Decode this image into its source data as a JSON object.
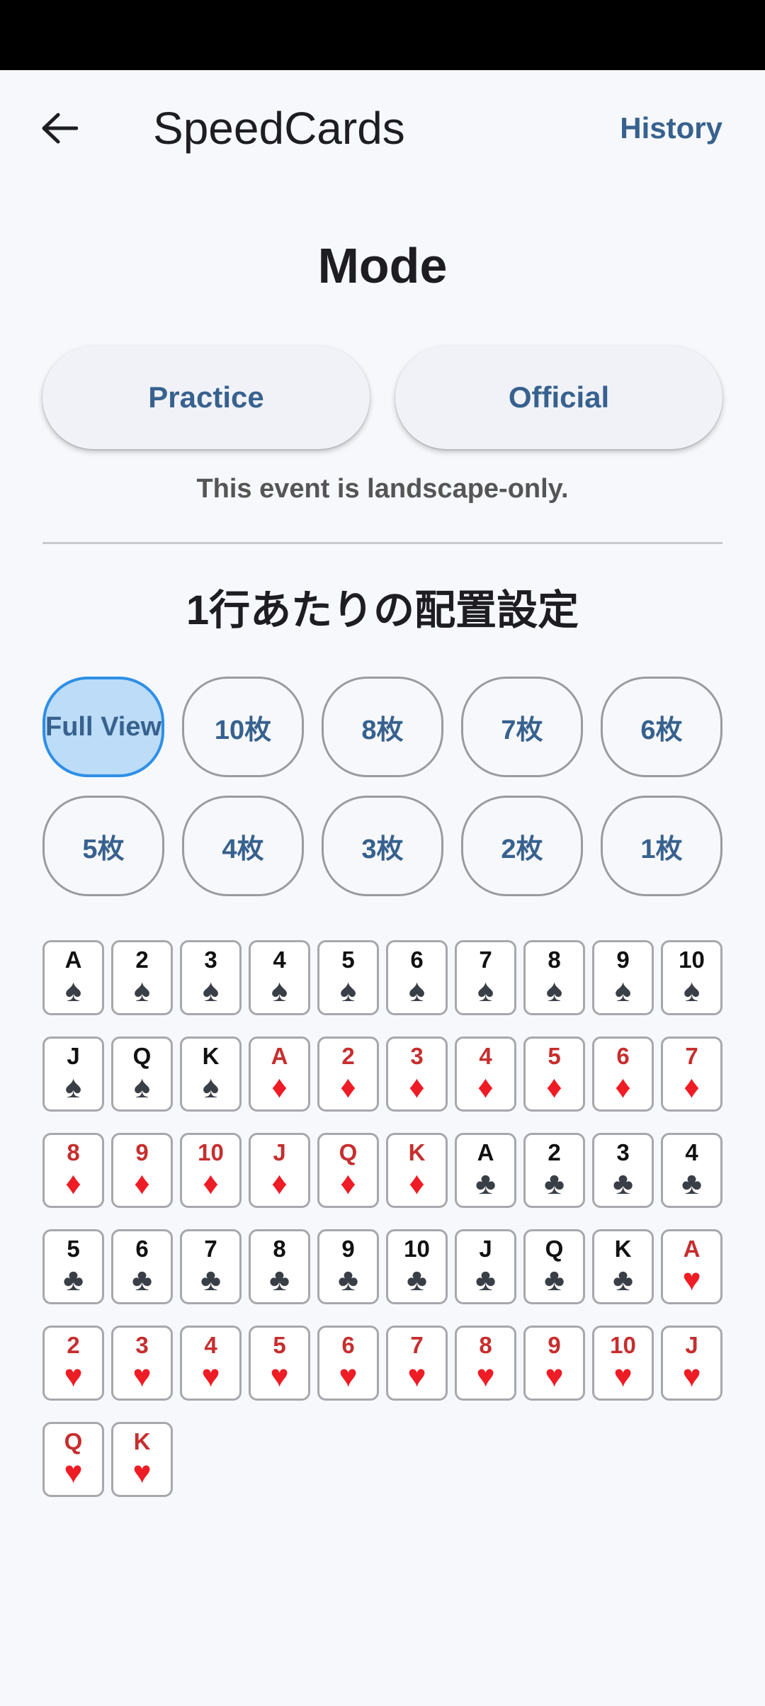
{
  "app_bar": {
    "title": "SpeedCards",
    "history_label": "History"
  },
  "mode": {
    "title": "Mode",
    "practice_label": "Practice",
    "official_label": "Official",
    "note": "This event is landscape-only."
  },
  "layout": {
    "title": "1行あたりの配置設定",
    "options": [
      "Full View",
      "10枚",
      "8枚",
      "7枚",
      "6枚",
      "5枚",
      "4枚",
      "3枚",
      "2枚",
      "1枚"
    ],
    "selected": "Full View"
  },
  "colors": {
    "accent": "#37618e",
    "selected_fill": "#bcdcf7",
    "selected_border": "#2e8fe5",
    "red_suit": "#ee1c24",
    "black_suit": "#3a3f47"
  },
  "cards": [
    {
      "rank": "A",
      "suit": "spade"
    },
    {
      "rank": "2",
      "suit": "spade"
    },
    {
      "rank": "3",
      "suit": "spade"
    },
    {
      "rank": "4",
      "suit": "spade"
    },
    {
      "rank": "5",
      "suit": "spade"
    },
    {
      "rank": "6",
      "suit": "spade"
    },
    {
      "rank": "7",
      "suit": "spade"
    },
    {
      "rank": "8",
      "suit": "spade"
    },
    {
      "rank": "9",
      "suit": "spade"
    },
    {
      "rank": "10",
      "suit": "spade"
    },
    {
      "rank": "J",
      "suit": "spade"
    },
    {
      "rank": "Q",
      "suit": "spade"
    },
    {
      "rank": "K",
      "suit": "spade"
    },
    {
      "rank": "A",
      "suit": "diamond"
    },
    {
      "rank": "2",
      "suit": "diamond"
    },
    {
      "rank": "3",
      "suit": "diamond"
    },
    {
      "rank": "4",
      "suit": "diamond"
    },
    {
      "rank": "5",
      "suit": "diamond"
    },
    {
      "rank": "6",
      "suit": "diamond"
    },
    {
      "rank": "7",
      "suit": "diamond"
    },
    {
      "rank": "8",
      "suit": "diamond"
    },
    {
      "rank": "9",
      "suit": "diamond"
    },
    {
      "rank": "10",
      "suit": "diamond"
    },
    {
      "rank": "J",
      "suit": "diamond"
    },
    {
      "rank": "Q",
      "suit": "diamond"
    },
    {
      "rank": "K",
      "suit": "diamond"
    },
    {
      "rank": "A",
      "suit": "club"
    },
    {
      "rank": "2",
      "suit": "club"
    },
    {
      "rank": "3",
      "suit": "club"
    },
    {
      "rank": "4",
      "suit": "club"
    },
    {
      "rank": "5",
      "suit": "club"
    },
    {
      "rank": "6",
      "suit": "club"
    },
    {
      "rank": "7",
      "suit": "club"
    },
    {
      "rank": "8",
      "suit": "club"
    },
    {
      "rank": "9",
      "suit": "club"
    },
    {
      "rank": "10",
      "suit": "club"
    },
    {
      "rank": "J",
      "suit": "club"
    },
    {
      "rank": "Q",
      "suit": "club"
    },
    {
      "rank": "K",
      "suit": "club"
    },
    {
      "rank": "A",
      "suit": "heart"
    },
    {
      "rank": "2",
      "suit": "heart"
    },
    {
      "rank": "3",
      "suit": "heart"
    },
    {
      "rank": "4",
      "suit": "heart"
    },
    {
      "rank": "5",
      "suit": "heart"
    },
    {
      "rank": "6",
      "suit": "heart"
    },
    {
      "rank": "7",
      "suit": "heart"
    },
    {
      "rank": "8",
      "suit": "heart"
    },
    {
      "rank": "9",
      "suit": "heart"
    },
    {
      "rank": "10",
      "suit": "heart"
    },
    {
      "rank": "J",
      "suit": "heart"
    },
    {
      "rank": "Q",
      "suit": "heart"
    },
    {
      "rank": "K",
      "suit": "heart"
    }
  ]
}
